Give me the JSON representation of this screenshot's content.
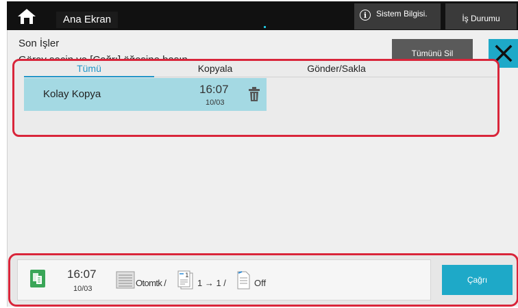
{
  "topbar": {
    "home_title": "Ana Ekran",
    "system_info_label": "Sistem Bilgisi.",
    "job_status_label": "İş Durumu",
    "icons": {
      "home": "home-icon",
      "info": "info-icon"
    }
  },
  "panel": {
    "title": "Son İşler",
    "instruction": "Görev seçin ve [Çağrı] öğesine basın.",
    "delete_all_label": "Tümünü Sil",
    "close_icon": "close-icon"
  },
  "tabs": [
    {
      "label": "Tümü",
      "active": true
    },
    {
      "label": "Kopyala",
      "active": false
    },
    {
      "label": "Gönder/Sakla",
      "active": false
    }
  ],
  "jobs": [
    {
      "name": "Kolay Kopya",
      "time": "16:07",
      "date": "10/03",
      "icon": "trash-icon"
    }
  ],
  "bottom": {
    "time": "16:07",
    "date": "10/03",
    "paper": "Otomtk /",
    "sides": "1 → 1 /",
    "staple": "Off",
    "recall_label": "Çağrı",
    "icons": {
      "job": "copy-job-icon",
      "paper": "paper-tray-icon",
      "sides": "duplex-icon",
      "staple": "staple-icon"
    }
  },
  "colors": {
    "accent": "#1ea9c8",
    "highlight_border": "#d9253a",
    "selected_row": "#a4d9e3",
    "topbar": "#111111"
  }
}
